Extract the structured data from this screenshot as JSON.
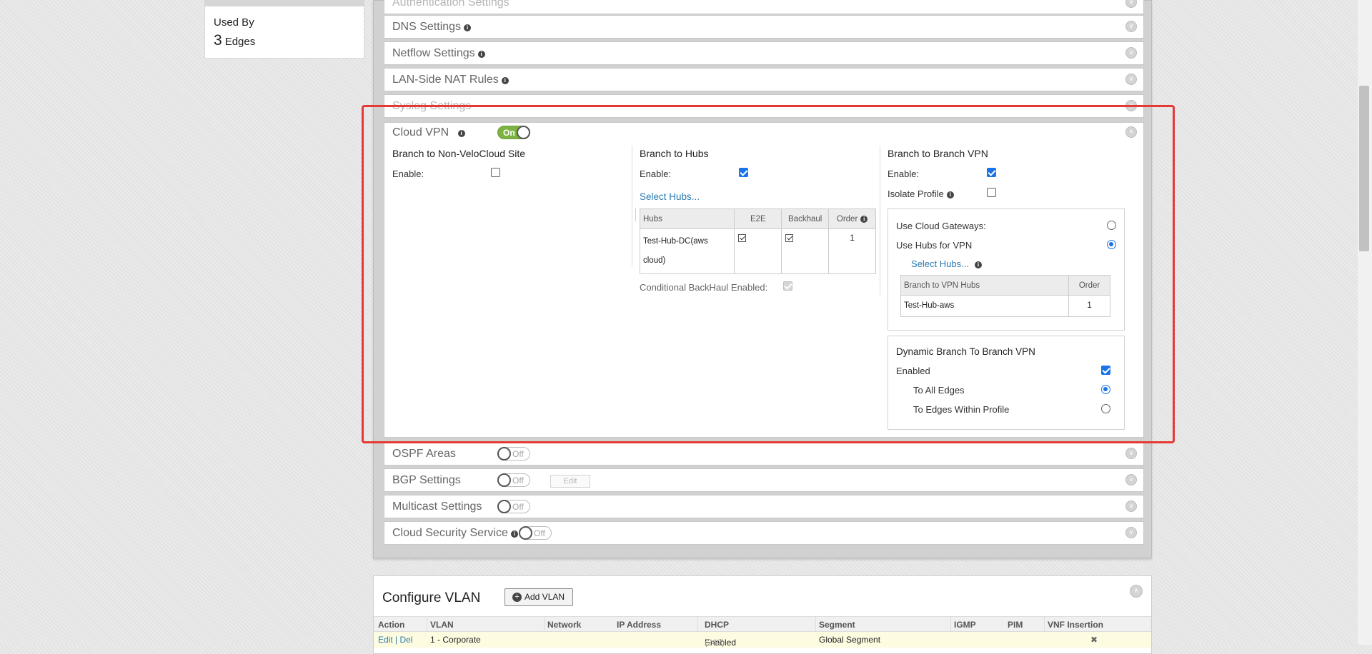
{
  "used_by": {
    "label": "Used By",
    "count": "3",
    "unit": "Edges"
  },
  "sections": {
    "auth": "Authentication Settings",
    "dns": "DNS Settings",
    "netflow": "Netflow Settings",
    "lan_nat": "LAN-Side NAT Rules",
    "syslog": "Syslog Settings",
    "cloud_vpn": "Cloud VPN",
    "ospf": "OSPF Areas",
    "bgp": "BGP Settings",
    "multicast": "Multicast Settings",
    "css": "Cloud Security Service"
  },
  "toggles": {
    "on": "On",
    "off": "Off"
  },
  "bgp_edit": "Edit",
  "cloud_vpn": {
    "non_velo": {
      "title": "Branch to Non-VeloCloud Site",
      "enable_label": "Enable:",
      "enabled": false
    },
    "hubs": {
      "title": "Branch to Hubs",
      "enable_label": "Enable:",
      "enabled": true,
      "select_link": "Select Hubs...",
      "table": {
        "headers": [
          "Hubs",
          "E2E",
          "Backhaul",
          "Order"
        ],
        "rows": [
          {
            "hub_line1": "Test-Hub-DC(aws",
            "hub_line2": "cloud)",
            "e2e": true,
            "backhaul": true,
            "order": "1"
          }
        ]
      },
      "conditional_label": "Conditional BackHaul Enabled:"
    },
    "b2b": {
      "title": "Branch to Branch VPN",
      "enable_label": "Enable:",
      "isolate_label": "Isolate Profile",
      "use_cloud_gw": "Use Cloud Gateways:",
      "use_hubs": "Use Hubs for VPN",
      "select_link": "Select Hubs...",
      "table_headers": [
        "Branch to VPN Hubs",
        "Order"
      ],
      "table_rows": [
        {
          "hub": "Test-Hub-aws",
          "order": "1"
        }
      ]
    },
    "dynamic": {
      "title": "Dynamic Branch To Branch VPN",
      "enabled_label": "Enabled",
      "all_edges": "To All Edges",
      "within_profile": "To Edges Within Profile"
    }
  },
  "vlan": {
    "title": "Configure VLAN",
    "add_button": "Add VLAN",
    "columns": [
      "Action",
      "VLAN",
      "Network",
      "IP Address",
      "DHCP",
      "Segment",
      "IGMP",
      "PIM",
      "VNF Insertion"
    ],
    "row": {
      "action": "Edit | Del",
      "vlan": "1 - Corporate",
      "dhcp": "Enabled",
      "dhcp_count": "(242)",
      "segment": "Global Segment"
    }
  },
  "colors": {
    "accent": "#1a73e8",
    "toggle_on": "#7cb342",
    "highlight": "#e53935",
    "link": "#2a7ab0"
  }
}
